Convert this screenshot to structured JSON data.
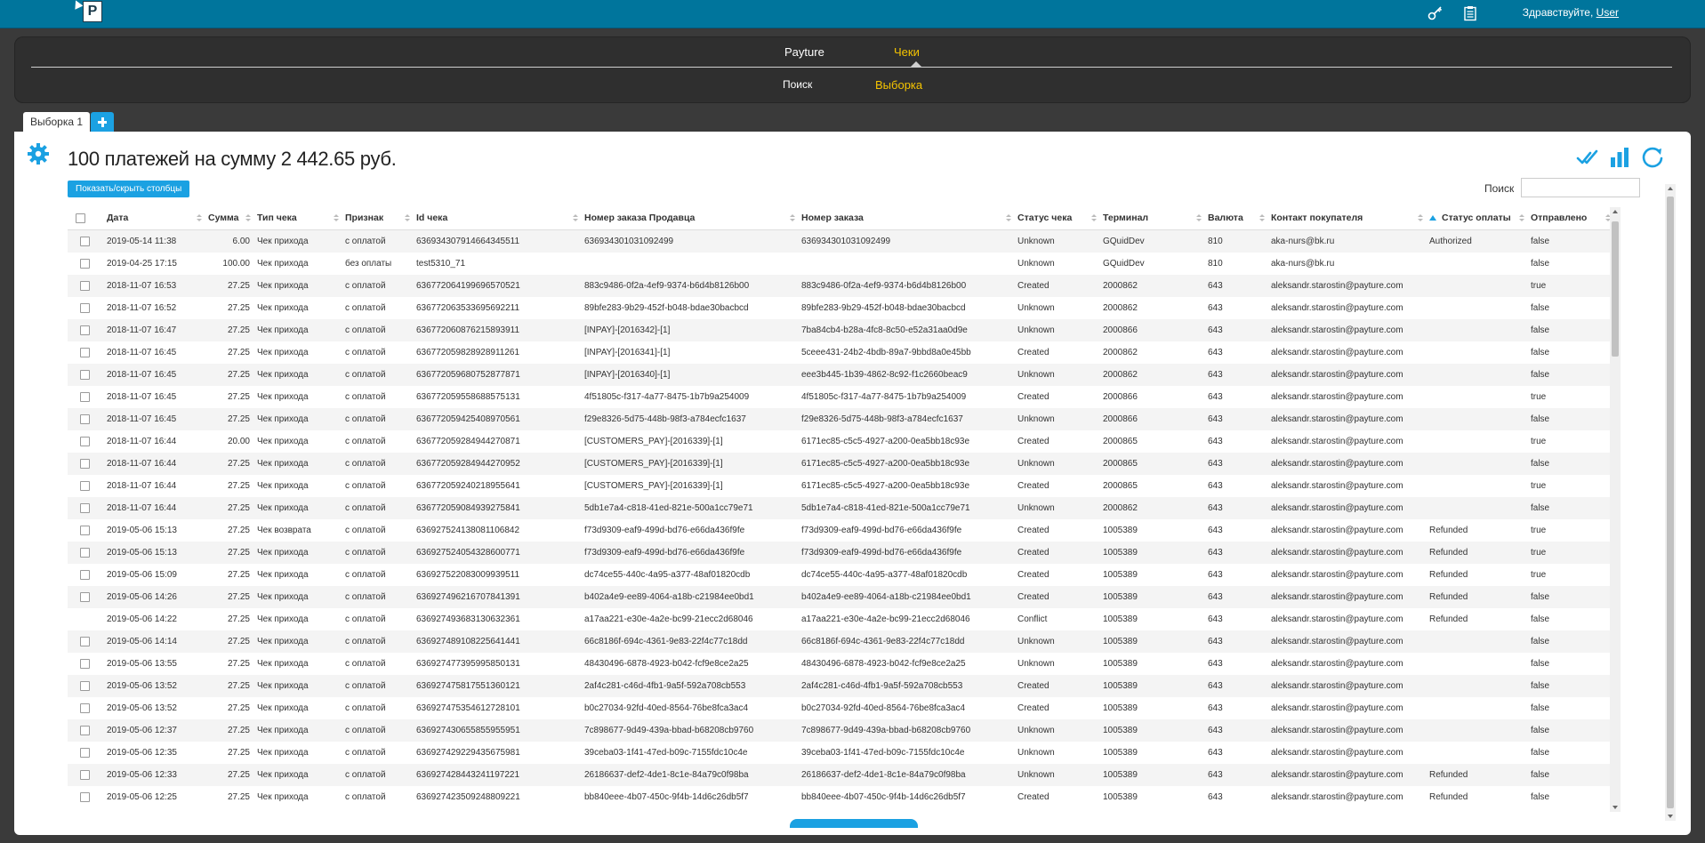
{
  "header": {
    "greeting_prefix": "Здравствуйте, ",
    "user": "User",
    "icons": [
      "key-icon",
      "clipboard-icon"
    ]
  },
  "nav": {
    "top": [
      {
        "label": "Payture",
        "active": false
      },
      {
        "label": "Чеки",
        "active": true
      }
    ],
    "sub": [
      {
        "label": "Поиск",
        "active": false
      },
      {
        "label": "Выборка",
        "active": true
      }
    ]
  },
  "tabs": {
    "items": [
      "Выборка 1"
    ]
  },
  "main": {
    "summary": "100 платежей на сумму 2 442.65 руб.",
    "toggle_columns": "Показать/скрыть столбцы",
    "search_label": "Поиск",
    "search_value": "",
    "columns": [
      "Дата",
      "Сумма",
      "Тип чека",
      "Признак",
      "Id чека",
      "Номер заказа Продавца",
      "Номер заказа",
      "Статус чека",
      "Терминал",
      "Валюта",
      "Контакт покупателя",
      "Статус оплаты",
      "Отправлено"
    ],
    "rows": [
      [
        "2019-05-14 11:38",
        "6.00",
        "Чек прихода",
        "с оплатой",
        "636934307914664345511",
        "636934301031092499",
        "636934301031092499",
        "Unknown",
        "GQuidDev",
        "810",
        "aka-nurs@bk.ru",
        "Authorized",
        "false"
      ],
      [
        "2019-04-25 17:15",
        "100.00",
        "Чек прихода",
        "без оплаты",
        "test5310_71",
        "",
        "",
        "Unknown",
        "GQuidDev",
        "810",
        "aka-nurs@bk.ru",
        "",
        "false"
      ],
      [
        "2018-11-07 16:53",
        "27.25",
        "Чек прихода",
        "с оплатой",
        "636772064199696570521",
        "883c9486-0f2a-4ef9-9374-b6d4b8126b00",
        "883c9486-0f2a-4ef9-9374-b6d4b8126b00",
        "Created",
        "2000862",
        "643",
        "aleksandr.starostin@payture.com",
        "",
        "true"
      ],
      [
        "2018-11-07 16:52",
        "27.25",
        "Чек прихода",
        "с оплатой",
        "636772063533695692211",
        "89bfe283-9b29-452f-b048-bdae30bacbcd",
        "89bfe283-9b29-452f-b048-bdae30bacbcd",
        "Unknown",
        "2000862",
        "643",
        "aleksandr.starostin@payture.com",
        "",
        "false"
      ],
      [
        "2018-11-07 16:47",
        "27.25",
        "Чек прихода",
        "с оплатой",
        "636772060876215893911",
        "[INPAY]-[2016342]-[1]",
        "7ba84cb4-b28a-4fc8-8c50-e52a31aa0d9e",
        "Unknown",
        "2000866",
        "643",
        "aleksandr.starostin@payture.com",
        "",
        "false"
      ],
      [
        "2018-11-07 16:45",
        "27.25",
        "Чек прихода",
        "с оплатой",
        "636772059828928911261",
        "[INPAY]-[2016341]-[1]",
        "5ceee431-24b2-4bdb-89a7-9bbd8a0e45bb",
        "Created",
        "2000862",
        "643",
        "aleksandr.starostin@payture.com",
        "",
        "false"
      ],
      [
        "2018-11-07 16:45",
        "27.25",
        "Чек прихода",
        "с оплатой",
        "636772059680752877871",
        "[INPAY]-[2016340]-[1]",
        "eee3b445-1b39-4862-8c92-f1c2660beac9",
        "Unknown",
        "2000862",
        "643",
        "aleksandr.starostin@payture.com",
        "",
        "false"
      ],
      [
        "2018-11-07 16:45",
        "27.25",
        "Чек прихода",
        "с оплатой",
        "636772059558688575131",
        "4f51805c-f317-4a77-8475-1b7b9a254009",
        "4f51805c-f317-4a77-8475-1b7b9a254009",
        "Created",
        "2000866",
        "643",
        "aleksandr.starostin@payture.com",
        "",
        "true"
      ],
      [
        "2018-11-07 16:45",
        "27.25",
        "Чек прихода",
        "с оплатой",
        "636772059425408970561",
        "f29e8326-5d75-448b-98f3-a784ecfc1637",
        "f29e8326-5d75-448b-98f3-a784ecfc1637",
        "Unknown",
        "2000866",
        "643",
        "aleksandr.starostin@payture.com",
        "",
        "false"
      ],
      [
        "2018-11-07 16:44",
        "20.00",
        "Чек прихода",
        "с оплатой",
        "636772059284944270871",
        "[CUSTOMERS_PAY]-[2016339]-[1]",
        "6171ec85-c5c5-4927-a200-0ea5bb18c93e",
        "Created",
        "2000865",
        "643",
        "aleksandr.starostin@payture.com",
        "",
        "true"
      ],
      [
        "2018-11-07 16:44",
        "27.25",
        "Чек прихода",
        "с оплатой",
        "636772059284944270952",
        "[CUSTOMERS_PAY]-[2016339]-[1]",
        "6171ec85-c5c5-4927-a200-0ea5bb18c93e",
        "Unknown",
        "2000865",
        "643",
        "aleksandr.starostin@payture.com",
        "",
        "false"
      ],
      [
        "2018-11-07 16:44",
        "27.25",
        "Чек прихода",
        "с оплатой",
        "636772059240218955641",
        "[CUSTOMERS_PAY]-[2016339]-[1]",
        "6171ec85-c5c5-4927-a200-0ea5bb18c93e",
        "Created",
        "2000865",
        "643",
        "aleksandr.starostin@payture.com",
        "",
        "true"
      ],
      [
        "2018-11-07 16:44",
        "27.25",
        "Чек прихода",
        "с оплатой",
        "636772059084939275841",
        "5db1e7a4-c818-41ed-821e-500a1cc79e71",
        "5db1e7a4-c818-41ed-821e-500a1cc79e71",
        "Unknown",
        "2000862",
        "643",
        "aleksandr.starostin@payture.com",
        "",
        "false"
      ],
      [
        "2019-05-06 15:13",
        "27.25",
        "Чек возврата",
        "с оплатой",
        "636927524138081106842",
        "f73d9309-eaf9-499d-bd76-e66da436f9fe",
        "f73d9309-eaf9-499d-bd76-e66da436f9fe",
        "Created",
        "1005389",
        "643",
        "aleksandr.starostin@payture.com",
        "Refunded",
        "true"
      ],
      [
        "2019-05-06 15:13",
        "27.25",
        "Чек прихода",
        "с оплатой",
        "636927524054328600771",
        "f73d9309-eaf9-499d-bd76-e66da436f9fe",
        "f73d9309-eaf9-499d-bd76-e66da436f9fe",
        "Created",
        "1005389",
        "643",
        "aleksandr.starostin@payture.com",
        "Refunded",
        "true"
      ],
      [
        "2019-05-06 15:09",
        "27.25",
        "Чек прихода",
        "с оплатой",
        "636927522083009939511",
        "dc74ce55-440c-4a95-a377-48af01820cdb",
        "dc74ce55-440c-4a95-a377-48af01820cdb",
        "Created",
        "1005389",
        "643",
        "aleksandr.starostin@payture.com",
        "Refunded",
        "true"
      ],
      [
        "2019-05-06 14:26",
        "27.25",
        "Чек прихода",
        "с оплатой",
        "636927496216707841391",
        "b402a4e9-ee89-4064-a18b-c21984ee0bd1",
        "b402a4e9-ee89-4064-a18b-c21984ee0bd1",
        "Created",
        "1005389",
        "643",
        "aleksandr.starostin@payture.com",
        "Refunded",
        "false"
      ],
      [
        "2019-05-06 14:22",
        "27.25",
        "Чек прихода",
        "с оплатой",
        "636927493683130632361",
        "a17aa221-e30e-4a2e-bc99-21ecc2d68046",
        "a17aa221-e30e-4a2e-bc99-21ecc2d68046",
        "Conflict",
        "1005389",
        "643",
        "aleksandr.starostin@payture.com",
        "Refunded",
        "false"
      ],
      [
        "2019-05-06 14:14",
        "27.25",
        "Чек прихода",
        "с оплатой",
        "636927489108225641441",
        "66c8186f-694c-4361-9e83-22f4c77c18dd",
        "66c8186f-694c-4361-9e83-22f4c77c18dd",
        "Unknown",
        "1005389",
        "643",
        "aleksandr.starostin@payture.com",
        "",
        "false"
      ],
      [
        "2019-05-06 13:55",
        "27.25",
        "Чек прихода",
        "с оплатой",
        "636927477395995850131",
        "48430496-6878-4923-b042-fcf9e8ce2a25",
        "48430496-6878-4923-b042-fcf9e8ce2a25",
        "Unknown",
        "1005389",
        "643",
        "aleksandr.starostin@payture.com",
        "",
        "false"
      ],
      [
        "2019-05-06 13:52",
        "27.25",
        "Чек прихода",
        "с оплатой",
        "636927475817551360121",
        "2af4c281-c46d-4fb1-9a5f-592a708cb553",
        "2af4c281-c46d-4fb1-9a5f-592a708cb553",
        "Created",
        "1005389",
        "643",
        "aleksandr.starostin@payture.com",
        "",
        "false"
      ],
      [
        "2019-05-06 13:52",
        "27.25",
        "Чек прихода",
        "с оплатой",
        "636927475354612728101",
        "b0c27034-92fd-40ed-8564-76be8fca3ac4",
        "b0c27034-92fd-40ed-8564-76be8fca3ac4",
        "Created",
        "1005389",
        "643",
        "aleksandr.starostin@payture.com",
        "",
        "false"
      ],
      [
        "2019-05-06 12:37",
        "27.25",
        "Чек прихода",
        "с оплатой",
        "636927430655855955951",
        "7c898677-9d49-439a-bbad-b68208cb9760",
        "7c898677-9d49-439a-bbad-b68208cb9760",
        "Unknown",
        "1005389",
        "643",
        "aleksandr.starostin@payture.com",
        "",
        "false"
      ],
      [
        "2019-05-06 12:35",
        "27.25",
        "Чек прихода",
        "с оплатой",
        "636927429229435675981",
        "39ceba03-1f41-47ed-b09c-7155fdc10c4e",
        "39ceba03-1f41-47ed-b09c-7155fdc10c4e",
        "Unknown",
        "1005389",
        "643",
        "aleksandr.starostin@payture.com",
        "",
        "false"
      ],
      [
        "2019-05-06 12:33",
        "27.25",
        "Чек прихода",
        "с оплатой",
        "636927428443241197221",
        "26186637-def2-4de1-8c1e-84a79c0f98ba",
        "26186637-def2-4de1-8c1e-84a79c0f98ba",
        "Unknown",
        "1005389",
        "643",
        "aleksandr.starostin@payture.com",
        "Refunded",
        "false"
      ],
      [
        "2019-05-06 12:25",
        "27.25",
        "Чек прихода",
        "с оплатой",
        "636927423509248809221",
        "bb840eee-4b07-450c-9f4b-14d6c26db5f7",
        "bb840eee-4b07-450c-9f4b-14d6c26db5f7",
        "Created",
        "1005389",
        "643",
        "aleksandr.starostin@payture.com",
        "Refunded",
        "false"
      ]
    ],
    "row_checkbox_hidden": [
      17
    ],
    "right_icons": [
      "double-check-icon",
      "bar-chart-icon",
      "refresh-icon"
    ],
    "accent_color": "#1ba1e2"
  }
}
